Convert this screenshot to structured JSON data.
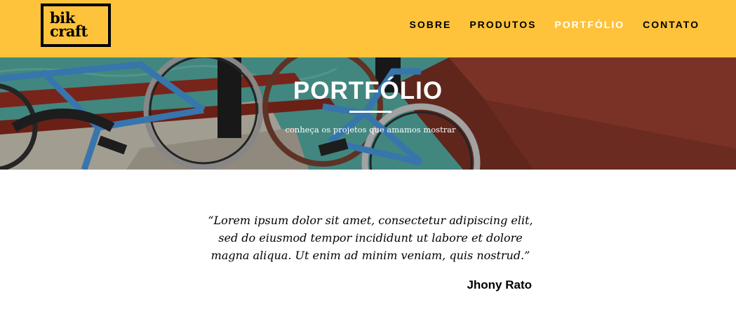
{
  "logo": {
    "line1": "bik",
    "line2": "craft"
  },
  "nav": {
    "items": [
      {
        "label": "SOBRE"
      },
      {
        "label": "PRODUTOS"
      },
      {
        "label": "PORTFÓLIO"
      },
      {
        "label": "CONTATO"
      }
    ]
  },
  "hero": {
    "title": "PORTFÓLIO",
    "subtitle": "conheça os projetos que amamos mostrar"
  },
  "testimonial": {
    "quote": "“Lorem ipsum dolor sit amet, consectetur adipiscing elit, sed do eiusmod tempor incididunt ut labore et dolore magna aliqua. Ut enim ad minim veniam, quis nostrud.”",
    "author": "Jhony Rato"
  },
  "colors": {
    "accent": "#fec33b",
    "text": "#000000",
    "active_nav": "#ffffff"
  }
}
